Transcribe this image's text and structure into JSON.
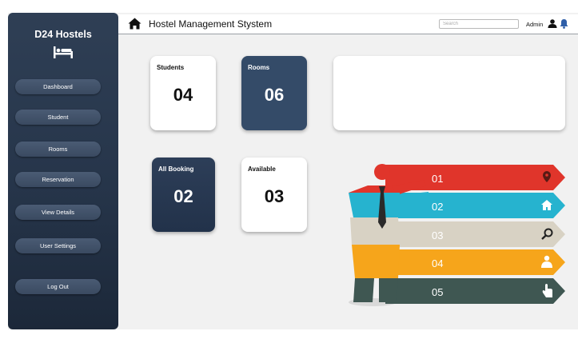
{
  "sidebar": {
    "brand": "D24 Hostels",
    "items": [
      {
        "label": "Dashboard"
      },
      {
        "label": "Student"
      },
      {
        "label": "Rooms"
      },
      {
        "label": "Reservation"
      },
      {
        "label": "View Details"
      },
      {
        "label": "User Settings"
      },
      {
        "label": "Log Out"
      }
    ]
  },
  "header": {
    "title": "Hostel Management Stystem",
    "search_placeholder": "Search",
    "user_label": "Admin"
  },
  "cards": [
    {
      "label": "Students",
      "value": "04"
    },
    {
      "label": "Rooms",
      "value": "06"
    },
    {
      "label": "All Booking",
      "value": "02"
    },
    {
      "label": "Available",
      "value": "03"
    }
  ],
  "infographic": {
    "steps": [
      {
        "number": "01",
        "color": "#e0352b",
        "icon": "location-pin-icon"
      },
      {
        "number": "02",
        "color": "#26b3cf",
        "icon": "home-icon"
      },
      {
        "number": "03",
        "color": "#d8d2c4",
        "icon": "magnifier-icon"
      },
      {
        "number": "04",
        "color": "#f6a51b",
        "icon": "person-icon"
      },
      {
        "number": "05",
        "color": "#3f5752",
        "icon": "pointer-hand-icon"
      }
    ]
  },
  "colors": {
    "sidebar": "#26354a",
    "card_dark": "#344b68",
    "background": "#f1f1f1"
  }
}
